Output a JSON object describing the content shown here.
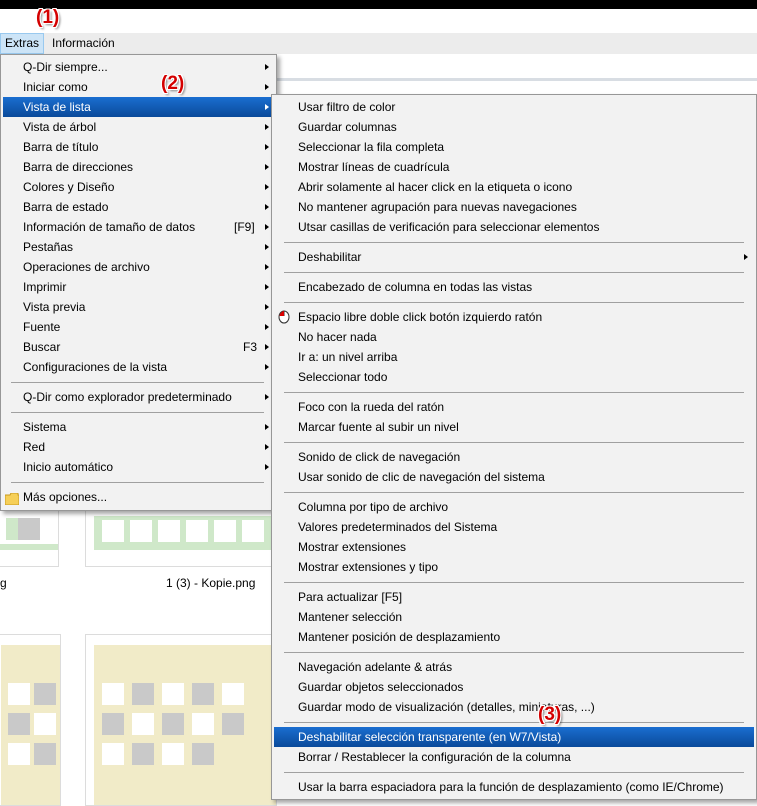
{
  "menubar": {
    "items": [
      {
        "label": "Extras"
      },
      {
        "label": "Información"
      }
    ]
  },
  "annotations": [
    "(1)",
    "(2)",
    "(3)"
  ],
  "background": {
    "file_label_left": "g",
    "file_label": "1 (3) - Kopie.png"
  },
  "extras_menu": {
    "items": [
      {
        "label": "Q-Dir siempre..."
      },
      {
        "label": "Iniciar como"
      },
      {
        "label": "Vista de lista"
      },
      {
        "label": "Vista de árbol"
      },
      {
        "label": "Barra de título"
      },
      {
        "label": "Barra de direcciones"
      },
      {
        "label": "Colores y Diseño"
      },
      {
        "label": "Barra de estado"
      },
      {
        "label": "Información de tamaño de datos",
        "shortcut": "[F9]"
      },
      {
        "label": "Pestañas"
      },
      {
        "label": "Operaciones de archivo"
      },
      {
        "label": "Imprimir"
      },
      {
        "label": "Vista previa"
      },
      {
        "label": "Fuente"
      },
      {
        "label": "Buscar",
        "shortcut": "F3"
      },
      {
        "label": "Configuraciones de la vista"
      },
      {
        "label": "Q-Dir como explorador predeterminado"
      },
      {
        "label": "Sistema"
      },
      {
        "label": "Red"
      },
      {
        "label": "Inicio automático"
      },
      {
        "label": "Más opciones..."
      }
    ]
  },
  "list_view_menu": {
    "items": [
      {
        "label": "Usar filtro de color"
      },
      {
        "label": "Guardar columnas"
      },
      {
        "label": "Seleccionar la fila completa"
      },
      {
        "label": "Mostrar líneas de cuadrícula"
      },
      {
        "label": "Abrir solamente al hacer click en la etiqueta o icono"
      },
      {
        "label": "No mantener agrupación para nuevas navegaciones"
      },
      {
        "label": "Utsar casillas de verificación para seleccionar elementos"
      },
      {
        "label": "Deshabilitar"
      },
      {
        "label": "Encabezado de columna en todas las vistas"
      },
      {
        "label": "Espacio libre doble click botón izquierdo ratón"
      },
      {
        "label": "No hacer nada"
      },
      {
        "label": "Ir a: un nivel arriba"
      },
      {
        "label": "Seleccionar todo"
      },
      {
        "label": "Foco con la rueda del ratón"
      },
      {
        "label": "Marcar fuente al subir un nivel"
      },
      {
        "label": "Sonido de click de navegación"
      },
      {
        "label": "Usar sonido de clic de navegación del sistema"
      },
      {
        "label": "Columna por tipo de archivo"
      },
      {
        "label": "Valores predeterminados del Sistema"
      },
      {
        "label": "Mostrar extensiones"
      },
      {
        "label": "Mostrar extensiones y tipo"
      },
      {
        "label": "Para actualizar [F5]"
      },
      {
        "label": "Mantener selección"
      },
      {
        "label": "Mantener posición de desplazamiento"
      },
      {
        "label": "Navegación adelante & atrás"
      },
      {
        "label": "Guardar objetos seleccionados"
      },
      {
        "label": "Guardar modo de visualización (detalles, miniaturas, ...)"
      },
      {
        "label": "Deshabilitar selección transparente (en W7/Vista)"
      },
      {
        "label": "Borrar / Restablecer la configuración de la columna"
      },
      {
        "label": "Usar la barra espaciadora para la función de desplazamiento (como IE/Chrome)"
      }
    ]
  }
}
